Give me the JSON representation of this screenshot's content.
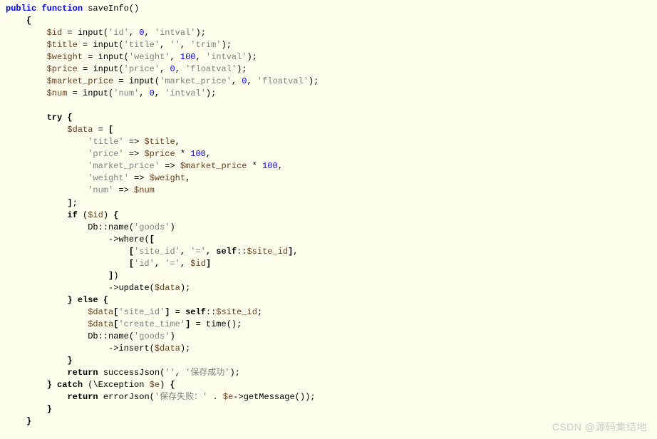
{
  "code": {
    "kw_public": "public",
    "kw_function": "function",
    "fn_saveInfo": "saveInfo",
    "brace_open": "{",
    "brace_close": "}",
    "var_id": "$id",
    "var_title": "$title",
    "var_weight": "$weight",
    "var_price": "$price",
    "var_market_price": "$market_price",
    "var_num": "$num",
    "var_data": "$data",
    "var_e": "$e",
    "fn_input": "input",
    "fn_name": "name",
    "fn_where": "where",
    "fn_update": "update",
    "fn_insert": "insert",
    "fn_time": "time",
    "fn_successJson": "successJson",
    "fn_errorJson": "errorJson",
    "fn_getMessage": "getMessage",
    "kw_try": "try",
    "kw_if": "if",
    "kw_else": "else",
    "kw_return": "return",
    "kw_catch": "catch",
    "kw_self": "self",
    "cls_Db": "Db",
    "cls_Exception": "Exception",
    "prop_site_id": "$site_id",
    "str_id": "'id'",
    "str_intval": "'intval'",
    "str_title": "'title'",
    "str_trim": "'trim'",
    "str_weight": "'weight'",
    "str_price": "'price'",
    "str_floatval": "'floatval'",
    "str_market_price": "'market_price'",
    "str_num": "'num'",
    "str_goods": "'goods'",
    "str_site_id": "'site_id'",
    "str_eq": "'='",
    "str_create_time": "'create_time'",
    "str_empty": "''",
    "str_save_success": "'保存成功'",
    "str_save_fail": "'保存失败：'",
    "num_0": "0",
    "num_100": "100",
    "arrow": "=>",
    "dcolon": "::",
    "arrow_obj": "->",
    "eq": " = ",
    "mult": " * ",
    "concat": " . ",
    "assign_bracket_open": "[",
    "assign_bracket_close": "]",
    "semi": ";",
    "comma": ",",
    "comma_sp": ", ",
    "paren_open": "(",
    "paren_close": ")",
    "bslash": "\\",
    "sq_open": "[",
    "sq_close": "]",
    "watermark": "CSDN @源码集结地"
  }
}
